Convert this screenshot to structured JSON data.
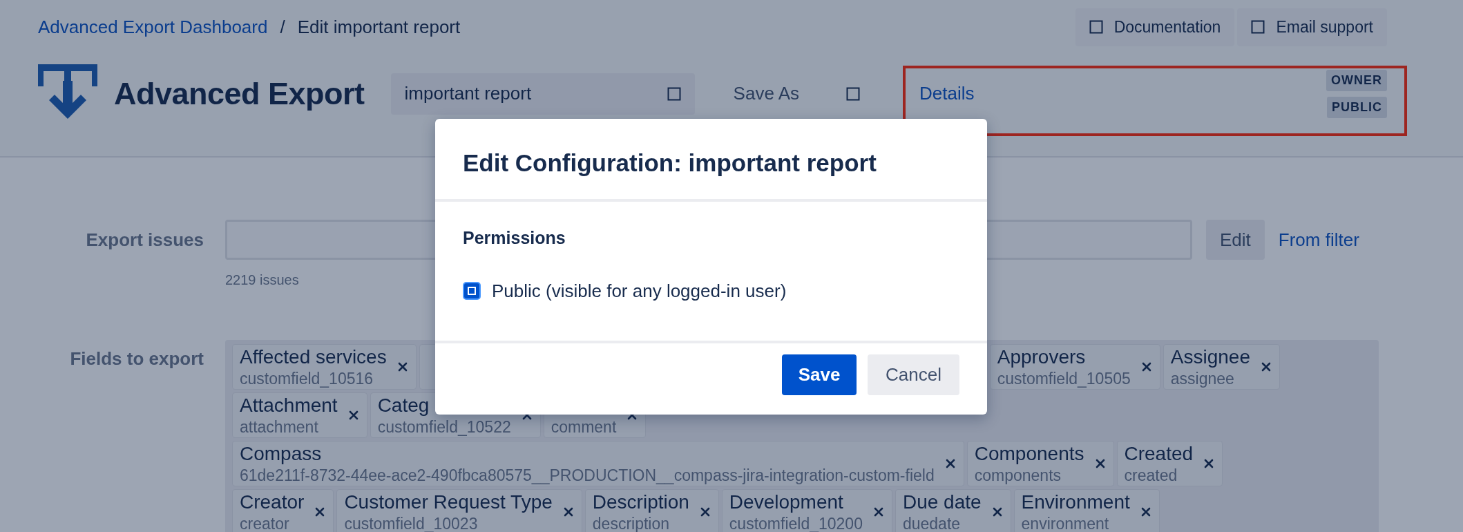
{
  "breadcrumb": [
    {
      "label": "Advanced Export Dashboard",
      "kind": "link"
    },
    {
      "label": "Edit important report",
      "kind": "current"
    }
  ],
  "breadcrumb_separator": "/",
  "help_buttons": [
    "Documentation",
    "Email support"
  ],
  "app_title": "Advanced Export",
  "report_name": {
    "value": "important report"
  },
  "save_as": "Save As",
  "details": "Details",
  "badges": [
    "OWNER",
    "PUBLIC"
  ],
  "export_issues": {
    "label": "Export issues",
    "edit": "Edit",
    "from_filter": "From filter",
    "count": "2219 issues"
  },
  "fields": {
    "label": "Fields to export",
    "tag_rows": [
      [
        {
          "kind": "tag",
          "name": "Affected services",
          "key": "customfield_10516"
        },
        {
          "kind": "covered"
        },
        {
          "kind": "tag",
          "name": "Approvers",
          "key": "customfield_10505"
        },
        {
          "kind": "tag",
          "name": "Assignee",
          "key": "assignee"
        }
      ],
      [
        {
          "kind": "tag",
          "name": "Attachment",
          "key": "attachment"
        },
        {
          "kind": "tag",
          "name": "Categ",
          "key": "customfield_10522"
        },
        {
          "kind": "tag",
          "key": "comment"
        }
      ],
      [
        {
          "kind": "tag",
          "name": "Compass",
          "key": "61de211f-8732-44ee-ace2-490fbca80575__PRODUCTION__compass-jira-integration-custom-field"
        },
        {
          "kind": "tag",
          "name": "Components",
          "key": "components"
        },
        {
          "kind": "tag",
          "name": "Created",
          "key": "created"
        }
      ],
      [
        {
          "kind": "tag",
          "name": "Creator",
          "key": "creator"
        },
        {
          "kind": "tag",
          "name": "Customer Request Type",
          "key": "customfield_10023"
        },
        {
          "kind": "tag",
          "name": "Description",
          "key": "description"
        },
        {
          "kind": "tag",
          "name": "Development",
          "key": "customfield_10200"
        },
        {
          "kind": "tag",
          "name": "Due date",
          "key": "duedate"
        },
        {
          "kind": "tag",
          "name": "Environment",
          "key": "environment"
        }
      ]
    ]
  },
  "modal": {
    "title": "Edit Configuration: important report",
    "section": "Permissions",
    "options": [
      {
        "label": "Public (visible for any logged-in user)",
        "checked": true
      }
    ],
    "buttons": [
      {
        "label": "Save",
        "kind": "primary"
      },
      {
        "label": "Cancel",
        "kind": "secondary"
      }
    ]
  }
}
